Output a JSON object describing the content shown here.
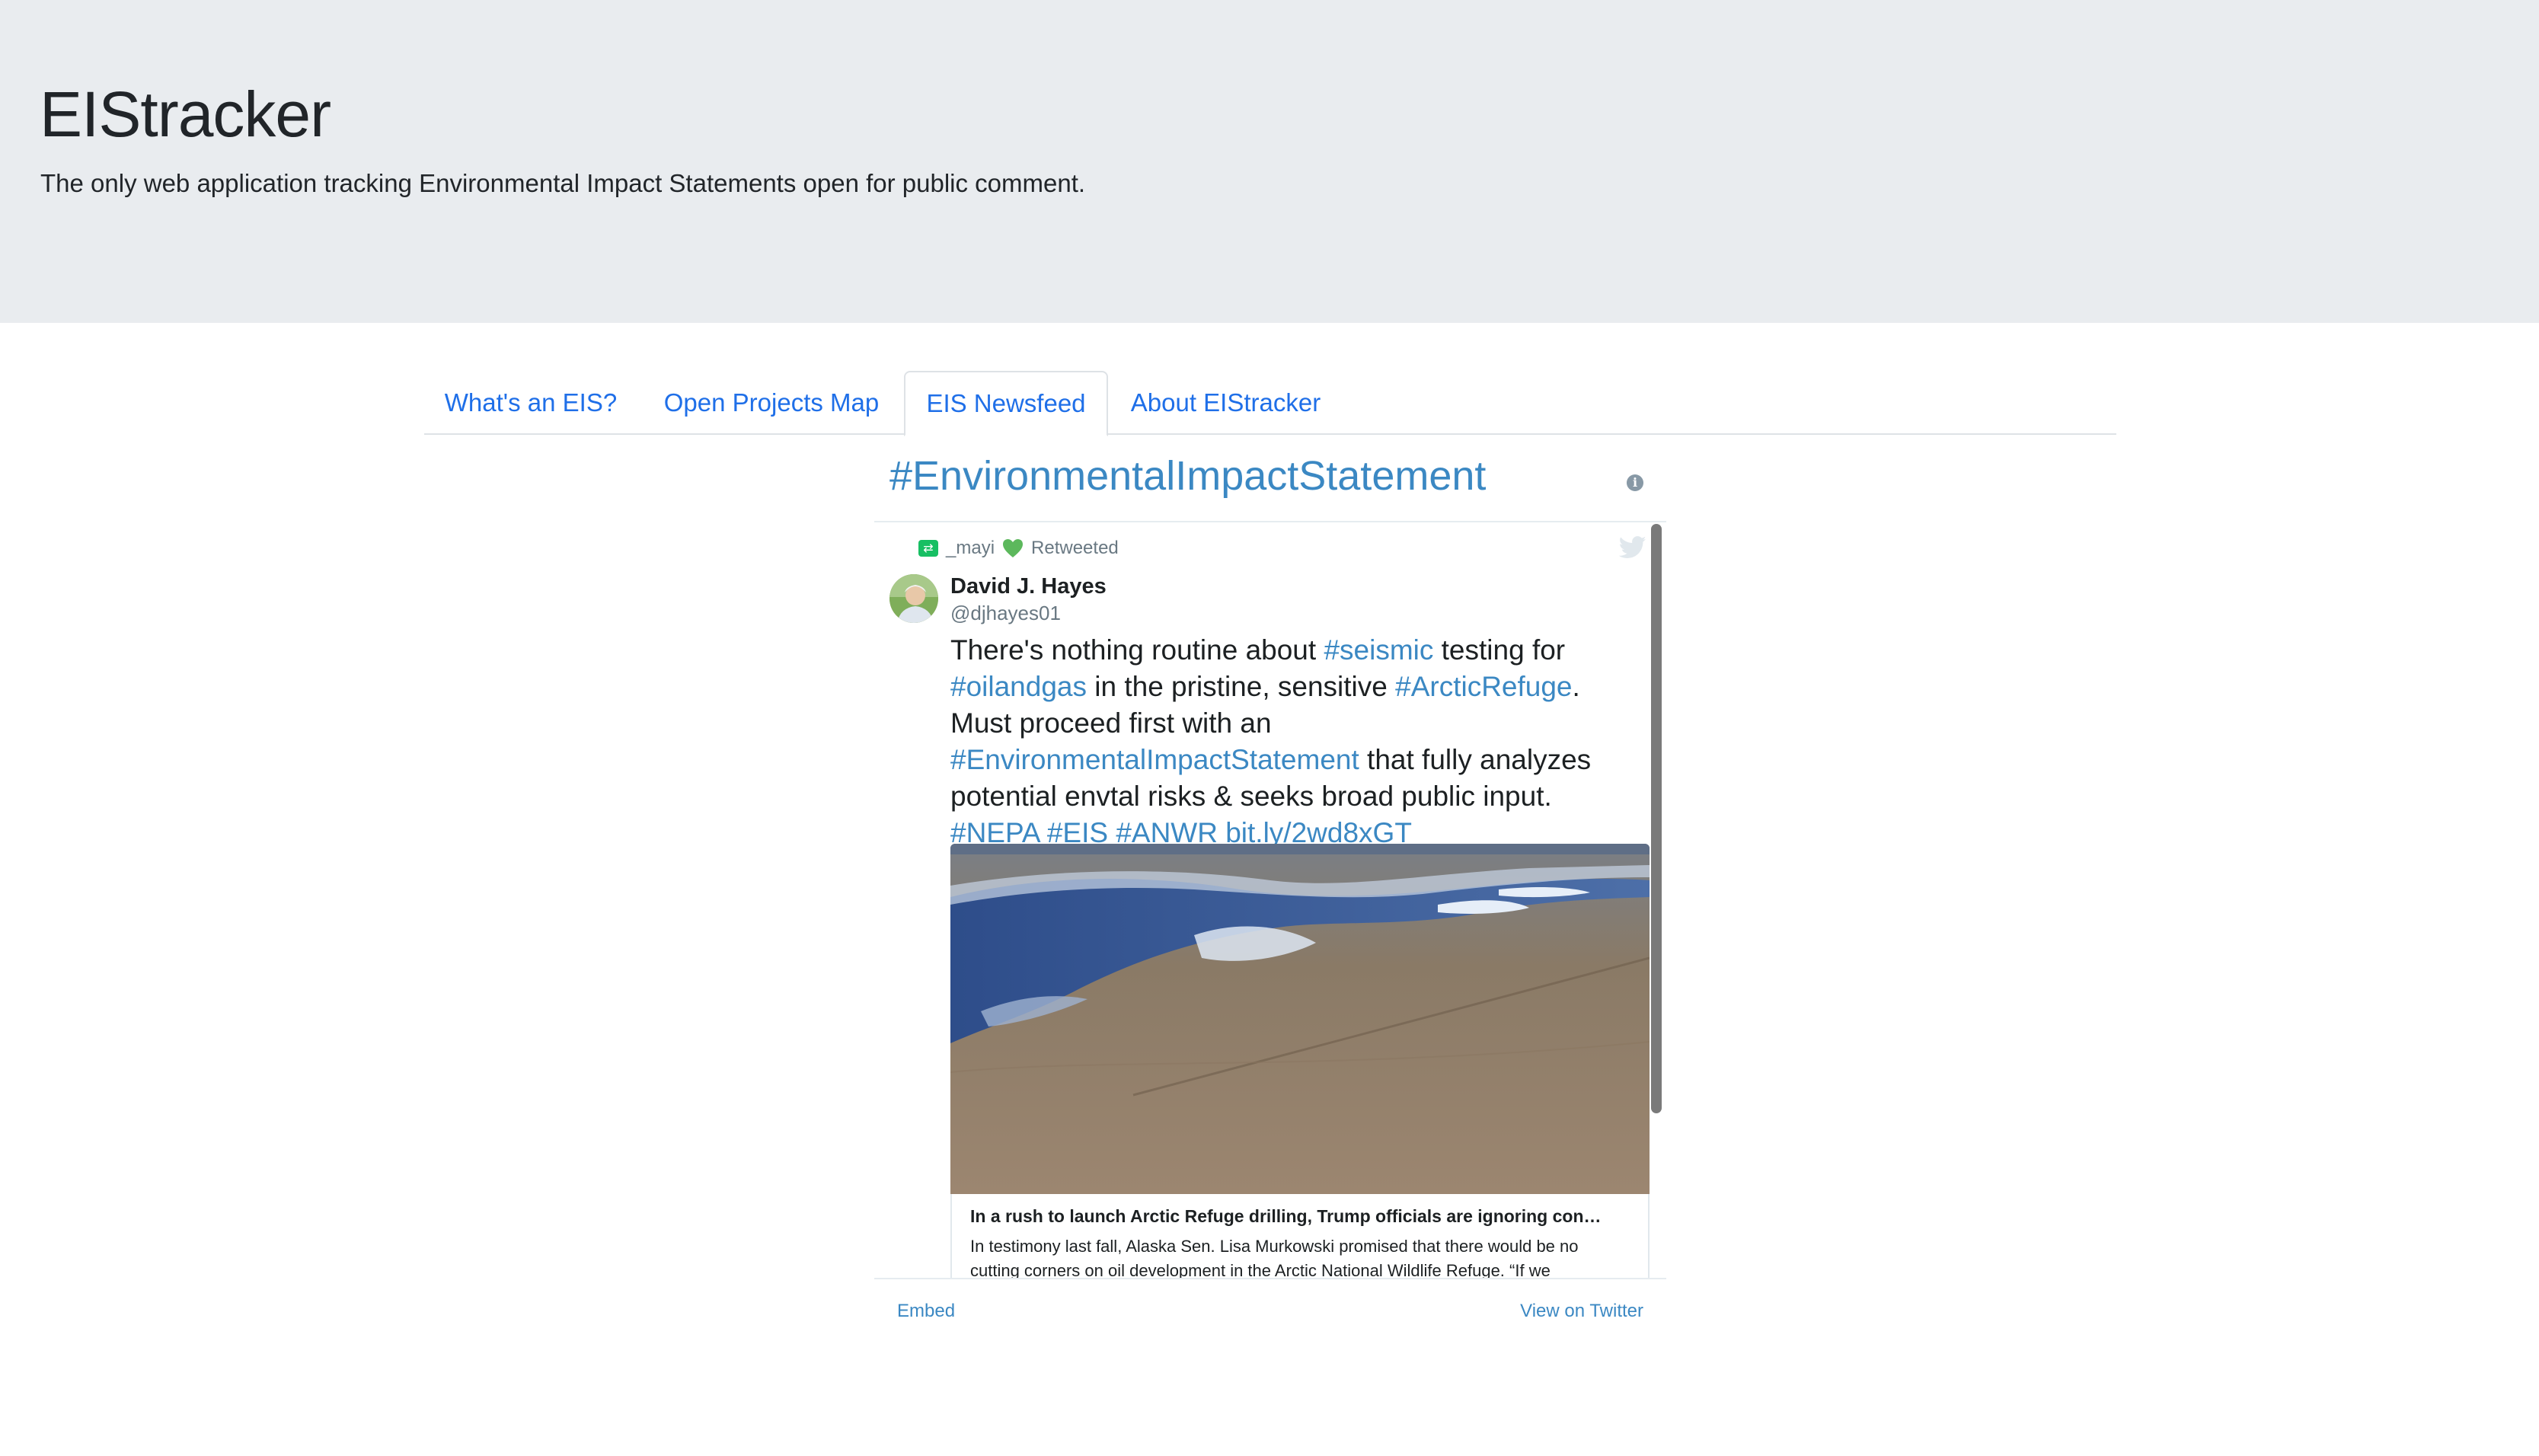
{
  "header": {
    "title": "EIStracker",
    "tagline": "The only web application tracking Environmental Impact Statements open for public comment."
  },
  "tabs": [
    {
      "label": "What's an EIS?",
      "active": false
    },
    {
      "label": "Open Projects Map",
      "active": false
    },
    {
      "label": "EIS Newsfeed",
      "active": true
    },
    {
      "label": "About EIStracker",
      "active": false
    }
  ],
  "timeline": {
    "title": "#EnvironmentalImpactStatement",
    "info_icon": "info-icon",
    "retweeter": "_mayi",
    "retweet_label": "Retweeted",
    "author_name": "David J. Hayes",
    "author_handle": "@djhayes01",
    "tweet": {
      "s1": "There's nothing routine about ",
      "h1": "#seismic",
      "s2": " testing for ",
      "h2": "#oilandgas",
      "s3": " in the pristine, sensitive ",
      "h3": "#ArcticRefuge",
      "s4": ". Must proceed first with an ",
      "h4": "#EnvironmentalImpactStatement",
      "s5": " that fully analyzes potential envtal risks & seeks broad public input. ",
      "h5": "#NEPA",
      "s6": " ",
      "h6": "#EIS",
      "s7": " ",
      "h7": "#ANWR",
      "s8": " ",
      "h8": "bit.ly/2wd8xGT"
    },
    "card_title": "In a rush to launch Arctic Refuge drilling, Trump officials are ignoring con…",
    "card_desc": "In testimony last fall, Alaska Sen. Lisa Murkowski promised that there would be no cutting corners on oil development in the Arctic National Wildlife Refuge. “If we",
    "embed_label": "Embed",
    "view_label": "View on Twitter"
  },
  "colors": {
    "jumbotron_bg": "#e9ecef",
    "tab_link": "#1f6fe8",
    "twitter_link": "#3b88c3",
    "retweet_green": "#17bf63"
  }
}
